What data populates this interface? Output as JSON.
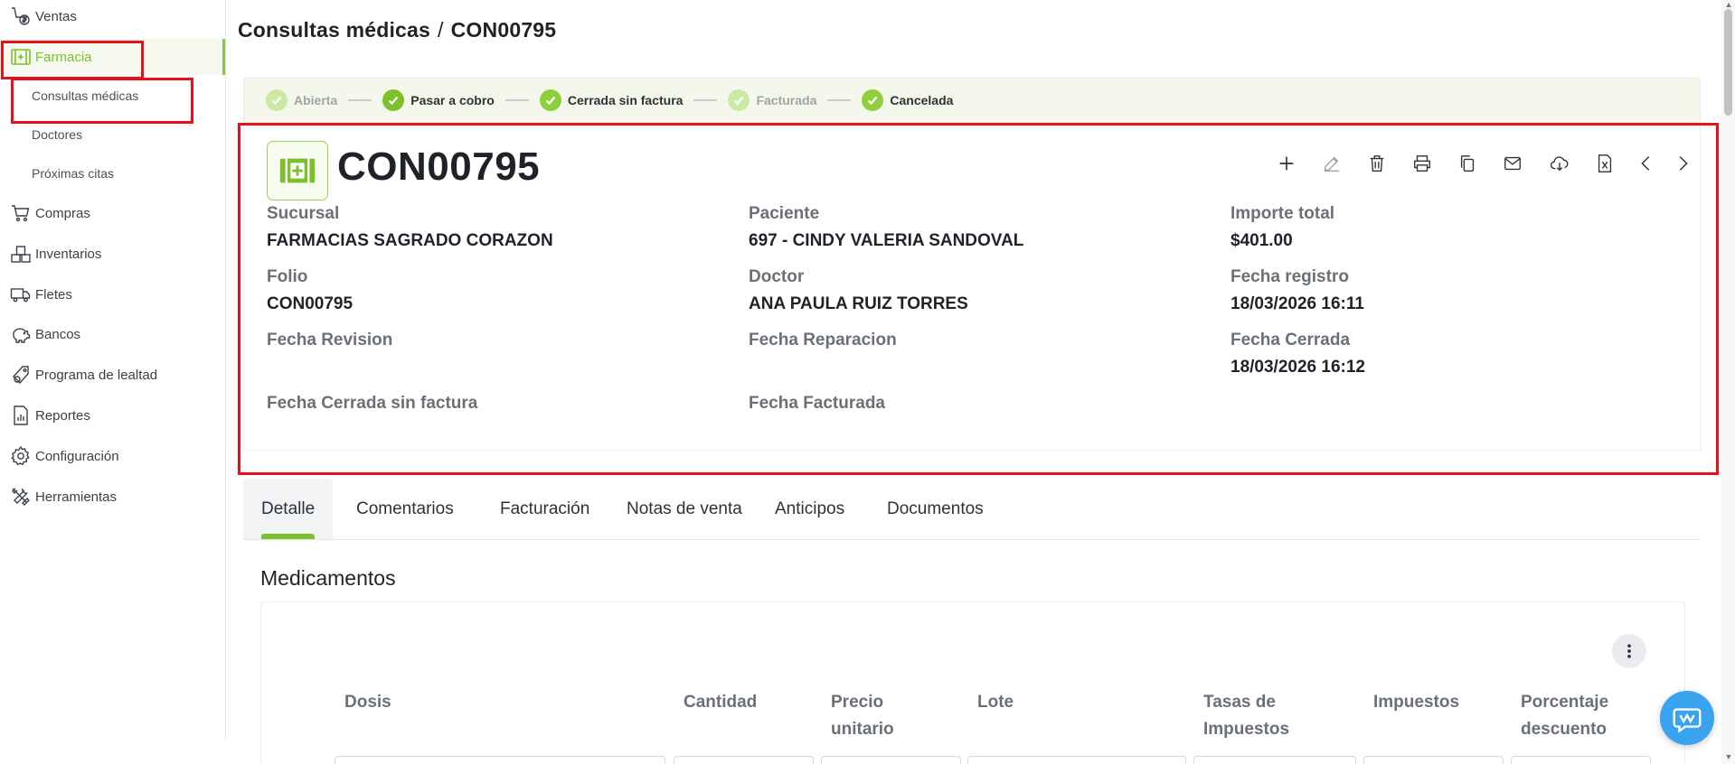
{
  "sidebar": {
    "items": [
      {
        "label": "Ventas",
        "icon": "sales-icon"
      },
      {
        "label": "Farmacia",
        "icon": "pharmacy-icon"
      },
      {
        "label": "Compras",
        "icon": "cart-icon"
      },
      {
        "label": "Inventarios",
        "icon": "boxes-icon"
      },
      {
        "label": "Fletes",
        "icon": "truck-icon"
      },
      {
        "label": "Bancos",
        "icon": "piggy-bank-icon"
      },
      {
        "label": "Programa de lealtad",
        "icon": "loyalty-icon"
      },
      {
        "label": "Reportes",
        "icon": "report-icon"
      },
      {
        "label": "Configuración",
        "icon": "gear-icon"
      },
      {
        "label": "Herramientas",
        "icon": "tools-icon"
      }
    ],
    "subitems": [
      {
        "label": "Consultas médicas"
      },
      {
        "label": "Doctores"
      },
      {
        "label": "Próximas citas"
      }
    ]
  },
  "header": {
    "breadcrumb_parent": "Consultas médicas",
    "breadcrumb_sep": "/",
    "breadcrumb_current": "CON00795"
  },
  "steps": [
    {
      "label": "Abierta",
      "state": "dim"
    },
    {
      "label": "Pasar a cobro",
      "state": "on"
    },
    {
      "label": "Cerrada sin factura",
      "state": "on"
    },
    {
      "label": "Facturada",
      "state": "dim"
    },
    {
      "label": "Cancelada",
      "state": "on"
    }
  ],
  "record": {
    "title": "CON00795",
    "actions": [
      "add-icon",
      "edit-icon",
      "delete-icon",
      "print-icon",
      "copy-icon",
      "mail-icon",
      "download-icon",
      "excel-icon",
      "prev-icon",
      "next-icon"
    ],
    "fields": {
      "sucursal_label": "Sucursal",
      "sucursal_value": "FARMACIAS SAGRADO CORAZON",
      "paciente_label": "Paciente",
      "paciente_value": "697 - CINDY VALERIA SANDOVAL",
      "importe_label": "Importe total",
      "importe_value": "$401.00",
      "folio_label": "Folio",
      "folio_value": "CON00795",
      "doctor_label": "Doctor",
      "doctor_value": "ANA PAULA RUIZ TORRES",
      "fecha_registro_label": "Fecha registro",
      "fecha_registro_value": "18/03/2026 16:11",
      "fecha_revision_label": "Fecha Revision",
      "fecha_reparacion_label": "Fecha Reparacion",
      "fecha_cerrada_label": "Fecha Cerrada",
      "fecha_cerrada_value": "18/03/2026 16:12",
      "fecha_cerrada_sin_factura_label": "Fecha Cerrada sin factura",
      "fecha_facturada_label": "Fecha Facturada"
    }
  },
  "tabs": [
    {
      "label": "Detalle"
    },
    {
      "label": "Comentarios"
    },
    {
      "label": "Facturación"
    },
    {
      "label": "Notas de venta"
    },
    {
      "label": "Anticipos"
    },
    {
      "label": "Documentos"
    }
  ],
  "section": {
    "title": "Medicamentos",
    "columns": [
      {
        "line1": "Dosis",
        "line2": ""
      },
      {
        "line1": "Cantidad",
        "line2": ""
      },
      {
        "line1": "Precio",
        "line2": "unitario"
      },
      {
        "line1": "Lote",
        "line2": ""
      },
      {
        "line1": "Tasas de",
        "line2": "Impuestos"
      },
      {
        "line1": "Impuestos",
        "line2": ""
      },
      {
        "line1": "Porcentaje",
        "line2": "descuento"
      }
    ]
  },
  "colors": {
    "accent": "#7cc12b",
    "highlight": "#e3131b",
    "chat": "#39a3f0"
  }
}
